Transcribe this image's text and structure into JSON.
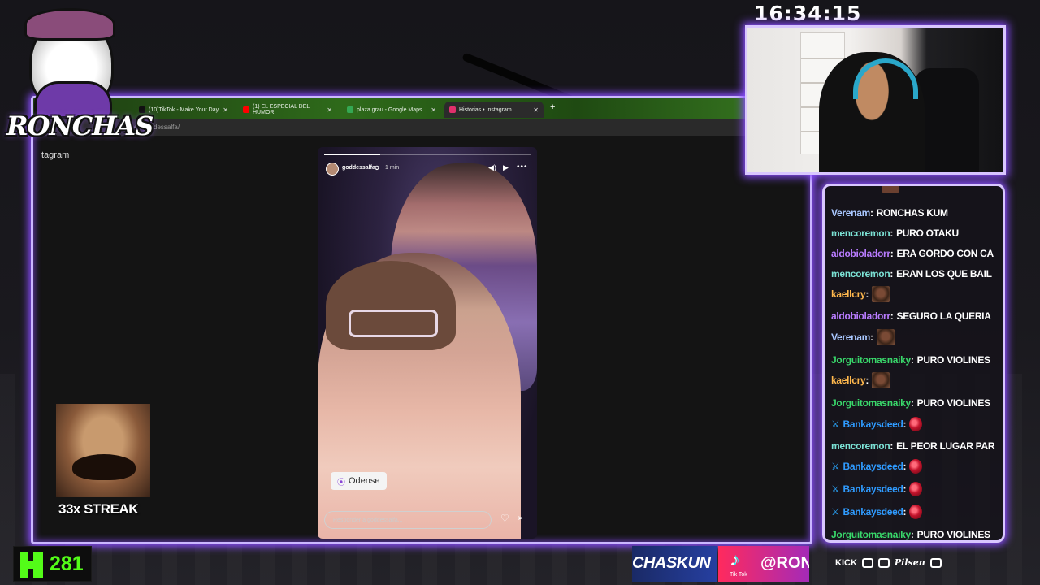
{
  "clock": "16:34:15",
  "logo": {
    "text": "RONCHAS",
    "sub": "tagram"
  },
  "browser": {
    "tabs": [
      {
        "label": "(10)TikTok - Make Your Day",
        "icon_color": "#111111",
        "active": false
      },
      {
        "label": "(1) EL ESPECIAL DEL HUMOR",
        "icon_color": "#ff0000",
        "active": false
      },
      {
        "label": "plaza grau - Google Maps",
        "icon_color": "#34a853",
        "active": false
      },
      {
        "label": "Historias • Instagram",
        "icon_color": "#e1306c",
        "active": true
      }
    ],
    "new_tab": "+",
    "url": "es/goddessalfa/"
  },
  "story": {
    "username": "goddessalfa",
    "time": "1 min",
    "progress": 0.27,
    "location": "Odense",
    "reply_placeholder": "Responder a goddessalfa..."
  },
  "streak": {
    "label": "33x STREAK"
  },
  "kick": {
    "count": "281",
    "accent": "#53fc18"
  },
  "banners": {
    "left_text": "CHASKUN",
    "tiktok_label": "Tik Tok",
    "tiktok_handle": "@RONC"
  },
  "sponsors": [
    "KICK",
    "Pilsen"
  ],
  "chat": [
    {
      "user": "Verenam",
      "color": "#a9c7ff",
      "text": "RONCHAS KUM"
    },
    {
      "user": "mencoremon",
      "color": "#7ce3d6",
      "text": "PURO OTAKU"
    },
    {
      "user": "aldobioladorr",
      "color": "#b97cff",
      "text": "ERA GORDO CON CA"
    },
    {
      "user": "mencoremon",
      "color": "#7ce3d6",
      "text": "ERAN LOS QUE BAIL"
    },
    {
      "user": "kaellcry",
      "color": "#ffb84d",
      "emote": "brown"
    },
    {
      "user": "aldobioladorr",
      "color": "#b97cff",
      "text": "SEGURO LA QUERIA"
    },
    {
      "user": "Verenam",
      "color": "#a9c7ff",
      "emote": "brown"
    },
    {
      "user": "Jorguitomasnaiky",
      "color": "#39d96b",
      "text": "PURO VIOLINES"
    },
    {
      "user": "kaellcry",
      "color": "#ffb84d",
      "emote": "brown"
    },
    {
      "user": "Jorguitomasnaiky",
      "color": "#39d96b",
      "text": "PURO VIOLINES"
    },
    {
      "user": "Bankaysdeed",
      "color": "#2f9bff",
      "badge": true,
      "emote": "red"
    },
    {
      "user": "mencoremon",
      "color": "#7ce3d6",
      "text": "EL PEOR LUGAR PAR"
    },
    {
      "user": "Bankaysdeed",
      "color": "#2f9bff",
      "badge": true,
      "emote": "red"
    },
    {
      "user": "Bankaysdeed",
      "color": "#2f9bff",
      "badge": true,
      "emote": "red"
    },
    {
      "user": "Bankaysdeed",
      "color": "#2f9bff",
      "badge": true,
      "emote": "red"
    },
    {
      "user": "Jorguitomasnaiky",
      "color": "#39d96b",
      "text": "PURO VIOLINES"
    }
  ]
}
